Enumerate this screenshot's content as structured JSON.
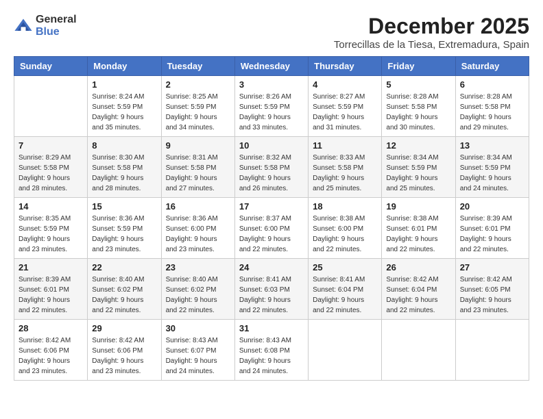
{
  "logo": {
    "general": "General",
    "blue": "Blue"
  },
  "title": "December 2025",
  "location": "Torrecillas de la Tiesa, Extremadura, Spain",
  "days_of_week": [
    "Sunday",
    "Monday",
    "Tuesday",
    "Wednesday",
    "Thursday",
    "Friday",
    "Saturday"
  ],
  "weeks": [
    [
      {
        "day": "",
        "info": ""
      },
      {
        "day": "1",
        "info": "Sunrise: 8:24 AM\nSunset: 5:59 PM\nDaylight: 9 hours\nand 35 minutes."
      },
      {
        "day": "2",
        "info": "Sunrise: 8:25 AM\nSunset: 5:59 PM\nDaylight: 9 hours\nand 34 minutes."
      },
      {
        "day": "3",
        "info": "Sunrise: 8:26 AM\nSunset: 5:59 PM\nDaylight: 9 hours\nand 33 minutes."
      },
      {
        "day": "4",
        "info": "Sunrise: 8:27 AM\nSunset: 5:59 PM\nDaylight: 9 hours\nand 31 minutes."
      },
      {
        "day": "5",
        "info": "Sunrise: 8:28 AM\nSunset: 5:58 PM\nDaylight: 9 hours\nand 30 minutes."
      },
      {
        "day": "6",
        "info": "Sunrise: 8:28 AM\nSunset: 5:58 PM\nDaylight: 9 hours\nand 29 minutes."
      }
    ],
    [
      {
        "day": "7",
        "info": ""
      },
      {
        "day": "8",
        "info": "Sunrise: 8:30 AM\nSunset: 5:58 PM\nDaylight: 9 hours\nand 28 minutes."
      },
      {
        "day": "9",
        "info": "Sunrise: 8:31 AM\nSunset: 5:58 PM\nDaylight: 9 hours\nand 27 minutes."
      },
      {
        "day": "10",
        "info": "Sunrise: 8:32 AM\nSunset: 5:58 PM\nDaylight: 9 hours\nand 26 minutes."
      },
      {
        "day": "11",
        "info": "Sunrise: 8:33 AM\nSunset: 5:58 PM\nDaylight: 9 hours\nand 25 minutes."
      },
      {
        "day": "12",
        "info": "Sunrise: 8:34 AM\nSunset: 5:59 PM\nDaylight: 9 hours\nand 25 minutes."
      },
      {
        "day": "13",
        "info": "Sunrise: 8:34 AM\nSunset: 5:59 PM\nDaylight: 9 hours\nand 24 minutes."
      }
    ],
    [
      {
        "day": "14",
        "info": ""
      },
      {
        "day": "15",
        "info": "Sunrise: 8:36 AM\nSunset: 5:59 PM\nDaylight: 9 hours\nand 23 minutes."
      },
      {
        "day": "16",
        "info": "Sunrise: 8:36 AM\nSunset: 6:00 PM\nDaylight: 9 hours\nand 23 minutes."
      },
      {
        "day": "17",
        "info": "Sunrise: 8:37 AM\nSunset: 6:00 PM\nDaylight: 9 hours\nand 22 minutes."
      },
      {
        "day": "18",
        "info": "Sunrise: 8:38 AM\nSunset: 6:00 PM\nDaylight: 9 hours\nand 22 minutes."
      },
      {
        "day": "19",
        "info": "Sunrise: 8:38 AM\nSunset: 6:01 PM\nDaylight: 9 hours\nand 22 minutes."
      },
      {
        "day": "20",
        "info": "Sunrise: 8:39 AM\nSunset: 6:01 PM\nDaylight: 9 hours\nand 22 minutes."
      }
    ],
    [
      {
        "day": "21",
        "info": ""
      },
      {
        "day": "22",
        "info": "Sunrise: 8:40 AM\nSunset: 6:02 PM\nDaylight: 9 hours\nand 22 minutes."
      },
      {
        "day": "23",
        "info": "Sunrise: 8:40 AM\nSunset: 6:02 PM\nDaylight: 9 hours\nand 22 minutes."
      },
      {
        "day": "24",
        "info": "Sunrise: 8:41 AM\nSunset: 6:03 PM\nDaylight: 9 hours\nand 22 minutes."
      },
      {
        "day": "25",
        "info": "Sunrise: 8:41 AM\nSunset: 6:04 PM\nDaylight: 9 hours\nand 22 minutes."
      },
      {
        "day": "26",
        "info": "Sunrise: 8:42 AM\nSunset: 6:04 PM\nDaylight: 9 hours\nand 22 minutes."
      },
      {
        "day": "27",
        "info": "Sunrise: 8:42 AM\nSunset: 6:05 PM\nDaylight: 9 hours\nand 23 minutes."
      }
    ],
    [
      {
        "day": "28",
        "info": "Sunrise: 8:42 AM\nSunset: 6:06 PM\nDaylight: 9 hours\nand 23 minutes."
      },
      {
        "day": "29",
        "info": "Sunrise: 8:42 AM\nSunset: 6:06 PM\nDaylight: 9 hours\nand 23 minutes."
      },
      {
        "day": "30",
        "info": "Sunrise: 8:43 AM\nSunset: 6:07 PM\nDaylight: 9 hours\nand 24 minutes."
      },
      {
        "day": "31",
        "info": "Sunrise: 8:43 AM\nSunset: 6:08 PM\nDaylight: 9 hours\nand 24 minutes."
      },
      {
        "day": "",
        "info": ""
      },
      {
        "day": "",
        "info": ""
      },
      {
        "day": "",
        "info": ""
      }
    ]
  ],
  "week1_sun_info": "Sunrise: 8:29 AM\nSunset: 5:58 PM\nDaylight: 9 hours\nand 28 minutes.",
  "week3_sun_info": "Sunrise: 8:35 AM\nSunset: 5:59 PM\nDaylight: 9 hours\nand 23 minutes.",
  "week4_sun_info": "Sunrise: 8:39 AM\nSunset: 6:01 PM\nDaylight: 9 hours\nand 22 minutes."
}
